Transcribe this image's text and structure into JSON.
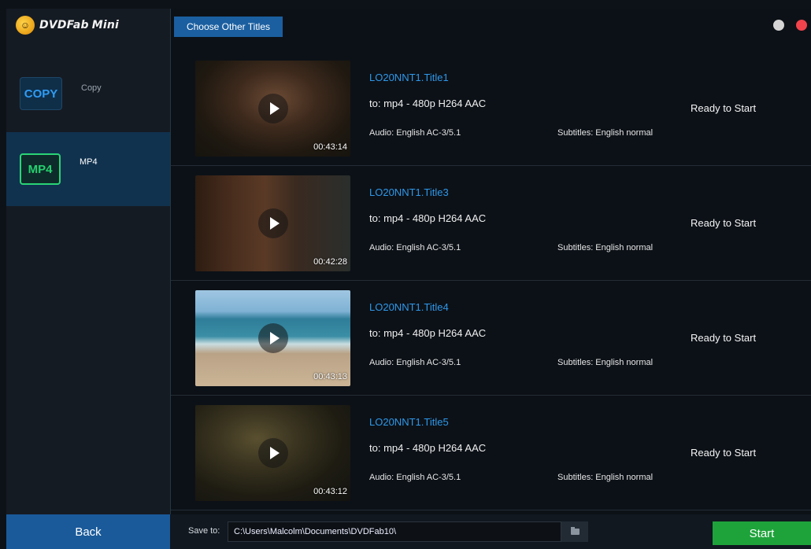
{
  "app": {
    "logo_text": "DVDFab",
    "logo_sub": "Mini",
    "colors": {
      "accent": "#1b5fa0",
      "title_link": "#2e98ea",
      "start": "#1ea33b",
      "mp4_badge": "#2ad476",
      "copy_badge": "#2f9cf4"
    }
  },
  "sidebar": {
    "modes": [
      {
        "badge": "COPY",
        "label": "Copy",
        "selected": false
      },
      {
        "badge": "MP4",
        "label": "MP4",
        "selected": true
      }
    ]
  },
  "toolbar": {
    "choose_other_titles": "Choose Other Titles",
    "window_controls": [
      "minimize-icon",
      "close-icon"
    ]
  },
  "titles": [
    {
      "name": "LO20NNT1.Title1",
      "format": "to: mp4 - 480p H264 AAC",
      "audio": "Audio:  English AC-3/5.1",
      "subtitles": "Subtitles:  English normal",
      "status": "Ready to Start",
      "duration": "00:43:14"
    },
    {
      "name": "LO20NNT1.Title3",
      "format": "to: mp4 - 480p H264 AAC",
      "audio": "Audio:  English AC-3/5.1",
      "subtitles": "Subtitles:  English normal",
      "status": "Ready to Start",
      "duration": "00:42:28"
    },
    {
      "name": "LO20NNT1.Title4",
      "format": "to: mp4 - 480p H264 AAC",
      "audio": "Audio:  English AC-3/5.1",
      "subtitles": "Subtitles:  English normal",
      "status": "Ready to Start",
      "duration": "00:43:13"
    },
    {
      "name": "LO20NNT1.Title5",
      "format": "to: mp4 - 480p H264 AAC",
      "audio": "Audio:  English AC-3/5.1",
      "subtitles": "Subtitles:  English normal",
      "status": "Ready to Start",
      "duration": "00:43:12"
    }
  ],
  "bottom": {
    "back_label": "Back",
    "save_to_label": "Save to:",
    "save_path": "C:\\Users\\Malcolm\\Documents\\DVDFab10\\",
    "start_label": "Start"
  }
}
